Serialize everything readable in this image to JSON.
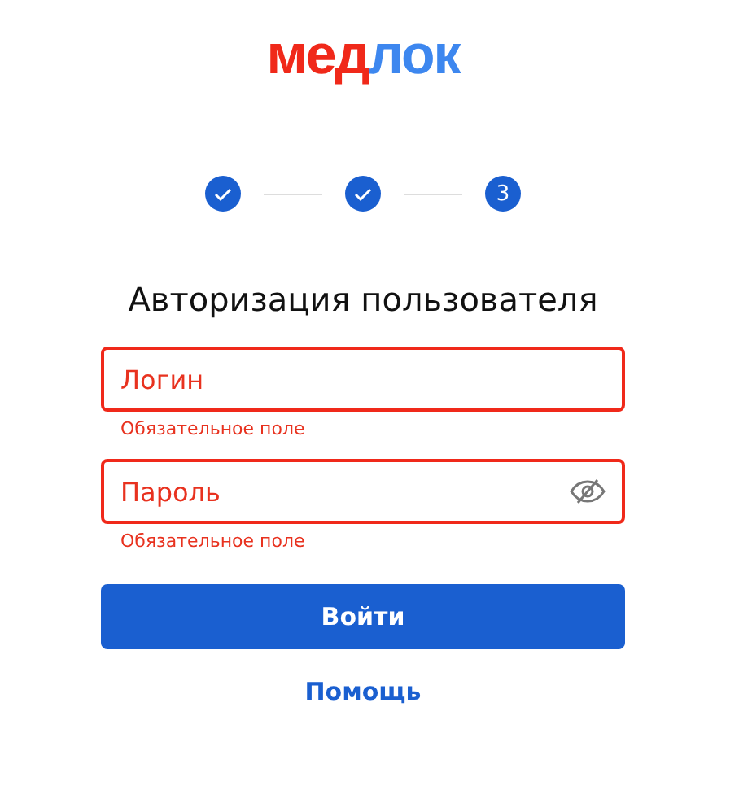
{
  "logo": [
    {
      "text": "мед",
      "color": "#f0291a"
    },
    {
      "text": "лок",
      "color": "#3d87ef"
    }
  ],
  "steps": [
    {
      "done": true
    },
    {
      "done": true
    },
    {
      "done": false,
      "label": "3"
    }
  ],
  "title": "Авторизация пользователя",
  "fields": [
    {
      "kind": "text",
      "placeholder": "Логин",
      "error": "Обязательное поле"
    },
    {
      "kind": "password",
      "placeholder": "Пароль",
      "error": "Обязательное поле"
    }
  ],
  "submit": "Войти",
  "help_link": "Помощь"
}
